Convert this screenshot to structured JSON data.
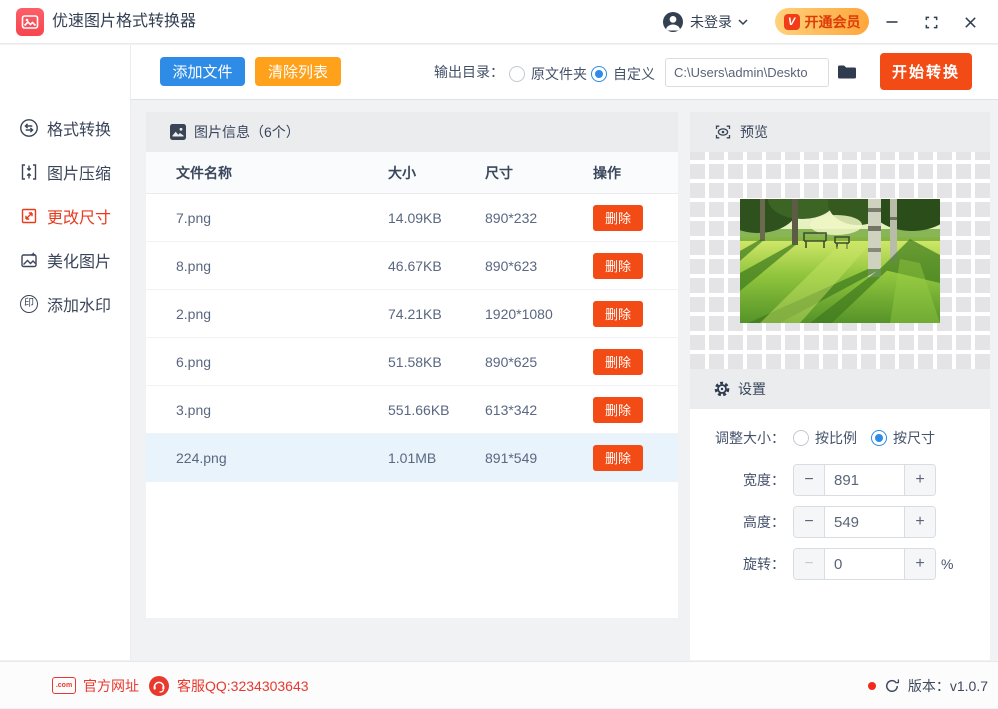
{
  "app": {
    "title": "优速图片格式转换器"
  },
  "titlebar": {
    "login_label": "未登录",
    "vip_label": "开通会员",
    "vip_badge_glyph": "V"
  },
  "toolbar": {
    "add_files": "添加文件",
    "clear_list": "清除列表",
    "output_dir_label": "输出目录：",
    "radio_original_folder": "原文件夹",
    "radio_custom": "自定义",
    "path_value": "C:\\Users\\admin\\Deskto",
    "start_convert": "开始转换"
  },
  "sidebar": {
    "items": [
      {
        "label": "格式转换"
      },
      {
        "label": "图片压缩"
      },
      {
        "label": "更改尺寸"
      },
      {
        "label": "美化图片"
      },
      {
        "label": "添加水印"
      }
    ]
  },
  "files_panel": {
    "title": "图片信息（6个）",
    "columns": {
      "name": "文件名称",
      "size": "大小",
      "dims": "尺寸",
      "ops": "操作"
    },
    "delete_label": "删除",
    "rows": [
      {
        "name": "7.png",
        "size": "14.09KB",
        "dims": "890*232"
      },
      {
        "name": "8.png",
        "size": "46.67KB",
        "dims": "890*623"
      },
      {
        "name": "2.png",
        "size": "74.21KB",
        "dims": "1920*1080"
      },
      {
        "name": "6.png",
        "size": "51.58KB",
        "dims": "890*625"
      },
      {
        "name": "3.png",
        "size": "551.66KB",
        "dims": "613*342"
      },
      {
        "name": "224.png",
        "size": "1.01MB",
        "dims": "891*549"
      }
    ],
    "selected_row": "224.png"
  },
  "preview_panel": {
    "title": "预览"
  },
  "settings_panel": {
    "title": "设置",
    "resize_label": "调整大小：",
    "radio_ratio": "按比例",
    "radio_size": "按尺寸",
    "width_label": "宽度：",
    "width_value": "891",
    "height_label": "高度：",
    "height_value": "549",
    "rotate_label": "旋转：",
    "rotate_value": "0",
    "rotate_unit": "%",
    "minus_glyph": "−",
    "plus_glyph": "+"
  },
  "footer": {
    "website_label": "官方网址",
    "qq_label": "客服QQ:3234303643",
    "version_label": "版本：v1.0.7"
  },
  "icons": {
    "watermark_glyph": "印",
    "com_glyph": ".com"
  },
  "colors": {
    "accent_blue": "#2e8ce6",
    "accent_orange": "#ffa11a",
    "accent_red": "#f34b16",
    "sidebar_active_red": "#e83a1f",
    "footer_red": "#e8392f",
    "vip_gradient_start": "#ffd27c",
    "vip_gradient_end": "#ffa63c",
    "panel_header_bg": "#ebecee",
    "selected_row_bg": "#e8f3fb",
    "main_bg": "#f1f2f4"
  }
}
